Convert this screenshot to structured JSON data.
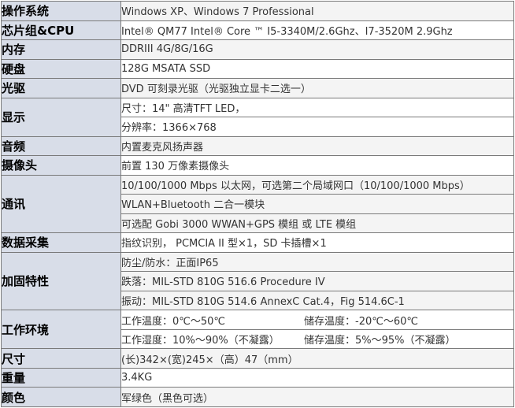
{
  "rows": [
    {
      "label": "操作系统",
      "values": [
        "Windows XP、Windows 7 Professional"
      ]
    },
    {
      "label": "芯片组&CPU",
      "values": [
        "Intel® QM77 Intel® Core ™ I5-3340M/2.6Ghz、I7-3520M 2.9Ghz"
      ]
    },
    {
      "label": "内存",
      "values": [
        "DDRIII 4G/8G/16G"
      ]
    },
    {
      "label": "硬盘",
      "values": [
        "128G MSATA SSD"
      ]
    },
    {
      "label": "光驱",
      "values": [
        "DVD 可刻录光驱（光驱独立显卡二选一）"
      ]
    },
    {
      "label": "显示",
      "values": [
        "尺寸：14\" 高清TFT LED，",
        "分辨率：1366×768"
      ]
    },
    {
      "label": "音频",
      "values": [
        "内置麦克风扬声器"
      ]
    },
    {
      "label": "摄像头",
      "values": [
        "前置 130 万像素摄像头"
      ]
    },
    {
      "label": "通讯",
      "values": [
        "10/100/1000 Mbps 以太网，可选第二个局域网口（10/100/1000 Mbps）",
        "WLAN+Bluetooth 二合一模块",
        "可选配 Gobi 3000 WWAN+GPS 模组 或 LTE 模组"
      ]
    },
    {
      "label": "数据采集",
      "values": [
        "指纹识别， PCMCIA II 型×1，SD 卡插槽×1"
      ]
    },
    {
      "label": "加固特性",
      "values": [
        "防尘/防水：正面IP65",
        "跌落：MIL-STD 810G 516.6 Procedure IV",
        "振动：MIL-STD 810G 514.6 AnnexC Cat.4，Fig 514.6C-1"
      ]
    },
    {
      "label": "工作环境",
      "split": [
        {
          "left": "工作温度：0℃～50℃",
          "right": "储存温度：-20℃～60℃"
        },
        {
          "left": "工作湿度：10%～90%（不凝露）",
          "right": "储存温度：5%～95%（不凝露）"
        }
      ]
    },
    {
      "label": "尺寸",
      "values": [
        "(长)342×(宽)245×（高）47（mm）"
      ]
    },
    {
      "label": "重量",
      "values": [
        "3.4KG"
      ]
    },
    {
      "label": "颜色",
      "values": [
        "军绿色（黑色可选）"
      ]
    }
  ]
}
